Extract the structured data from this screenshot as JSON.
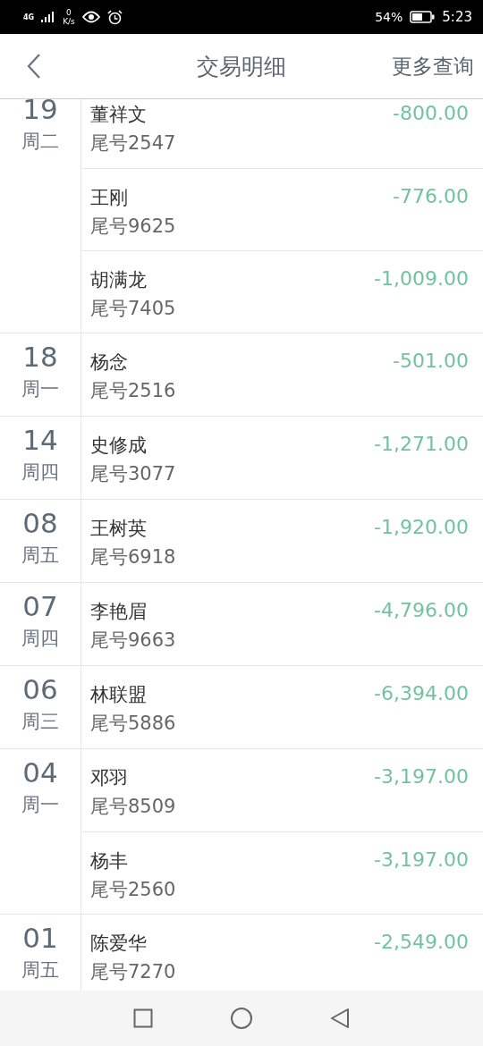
{
  "status_bar": {
    "network": "4G",
    "speed_value": "0",
    "speed_unit": "K/s",
    "battery_percent": "54%",
    "time": "5:23"
  },
  "header": {
    "title": "交易明细",
    "action": "更多查询"
  },
  "groups": [
    {
      "day": "19",
      "weekday": "周二",
      "transactions": [
        {
          "name": "董祥文",
          "tail": "尾号2547",
          "amount": "-800.00"
        },
        {
          "name": "王刚",
          "tail": "尾号9625",
          "amount": "-776.00"
        },
        {
          "name": "胡满龙",
          "tail": "尾号7405",
          "amount": "-1,009.00"
        }
      ]
    },
    {
      "day": "18",
      "weekday": "周一",
      "transactions": [
        {
          "name": "杨念",
          "tail": "尾号2516",
          "amount": "-501.00"
        }
      ]
    },
    {
      "day": "14",
      "weekday": "周四",
      "transactions": [
        {
          "name": "史修成",
          "tail": "尾号3077",
          "amount": "-1,271.00"
        }
      ]
    },
    {
      "day": "08",
      "weekday": "周五",
      "transactions": [
        {
          "name": "王树英",
          "tail": "尾号6918",
          "amount": "-1,920.00"
        }
      ]
    },
    {
      "day": "07",
      "weekday": "周四",
      "transactions": [
        {
          "name": "李艳眉",
          "tail": "尾号9663",
          "amount": "-4,796.00"
        }
      ]
    },
    {
      "day": "06",
      "weekday": "周三",
      "transactions": [
        {
          "name": "林联盟",
          "tail": "尾号5886",
          "amount": "-6,394.00"
        }
      ]
    },
    {
      "day": "04",
      "weekday": "周一",
      "transactions": [
        {
          "name": "邓羽",
          "tail": "尾号8509",
          "amount": "-3,197.00"
        },
        {
          "name": "杨丰",
          "tail": "尾号2560",
          "amount": "-3,197.00"
        }
      ]
    },
    {
      "day": "01",
      "weekday": "周五",
      "transactions": [
        {
          "name": "陈爱华",
          "tail": "尾号7270",
          "amount": "-2,549.00"
        }
      ]
    }
  ]
}
